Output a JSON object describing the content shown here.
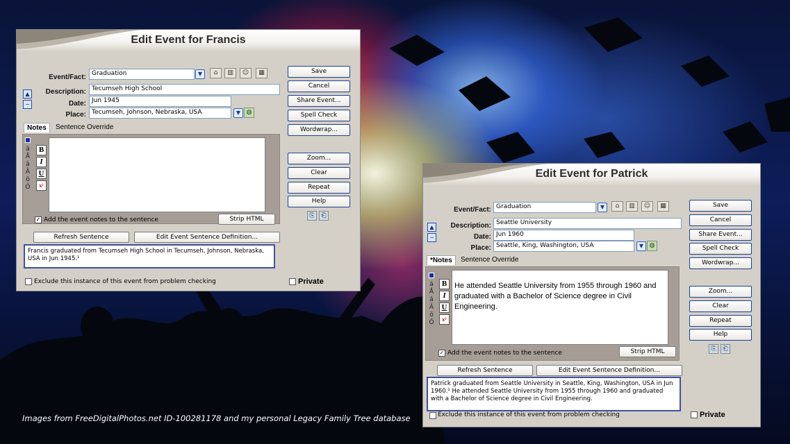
{
  "caption": "Images from FreeDigitalPhotos.net ID-100281178 and my personal Legacy Family Tree database",
  "colors": {
    "accent": "#3e4f9e",
    "button_border": "#1f3f8f",
    "notes_bg": "#a59d96"
  },
  "icons": [
    "house-icon",
    "books-icon",
    "people-icon",
    "calendar-icon",
    "globe-icon",
    "copy-icon",
    "paste-icon"
  ],
  "francis": {
    "title": "Edit Event for Francis",
    "labels": {
      "event": "Event/Fact:",
      "description": "Description:",
      "date": "Date:",
      "place": "Place:"
    },
    "event_value": "Graduation",
    "description_value": "Tecumseh High School",
    "date_value": "Jun 1945",
    "place_value": "Tecumseh, Johnson, Nebraska, USA",
    "tabs": [
      "Notes",
      "Sentence Override"
    ],
    "notes_text": "",
    "accents": [
      "ä",
      "Å",
      "â",
      "Ã",
      "ö",
      "Ö"
    ],
    "add_notes_label": "Add the event notes to the sentence",
    "strip_html": "Strip HTML",
    "refresh": "Refresh Sentence",
    "edit_def": "Edit Event Sentence Definition...",
    "sentence": "Francis graduated from Tecumseh High School in Tecumseh, Johnson, Nebraska, USA in Jun 1945.¹",
    "exclude_label": "Exclude this instance of this event from problem checking",
    "private": "Private",
    "buttons": [
      "Save",
      "Cancel",
      "Share Event...",
      "Spell Check",
      "Wordwrap...",
      "Zoom...",
      "Clear",
      "Repeat",
      "Help"
    ]
  },
  "patrick": {
    "title": "Edit Event for Patrick",
    "labels": {
      "event": "Event/Fact:",
      "description": "Description:",
      "date": "Date:",
      "place": "Place:"
    },
    "event_value": "Graduation",
    "description_value": "Seattle University",
    "date_value": "Jun 1960",
    "place_value": "Seattle, King, Washington, USA",
    "tabs": [
      "*Notes",
      "Sentence Override"
    ],
    "notes_text": "He attended Seattle University from 1955 through 1960 and graduated with a Bachelor of Science degree in Civil Engineering.",
    "accents": [
      "ä",
      "Å",
      "â",
      "Ã",
      "ö",
      "Ö"
    ],
    "add_notes_label": "Add the event notes to the sentence",
    "strip_html": "Strip HTML",
    "refresh": "Refresh Sentence",
    "edit_def": "Edit Event Sentence Definition...",
    "sentence": "Patrick graduated from Seattle University in Seattle, King, Washington, USA in Jun 1960.¹ He attended Seattle University from 1955 through 1960 and graduated with a Bachelor of Science degree in Civil Engineering.",
    "exclude_label": "Exclude this instance of this event from problem checking",
    "private": "Private",
    "buttons": [
      "Save",
      "Cancel",
      "Share Event...",
      "Spell Check",
      "Wordwrap...",
      "Zoom...",
      "Clear",
      "Repeat",
      "Help"
    ]
  }
}
